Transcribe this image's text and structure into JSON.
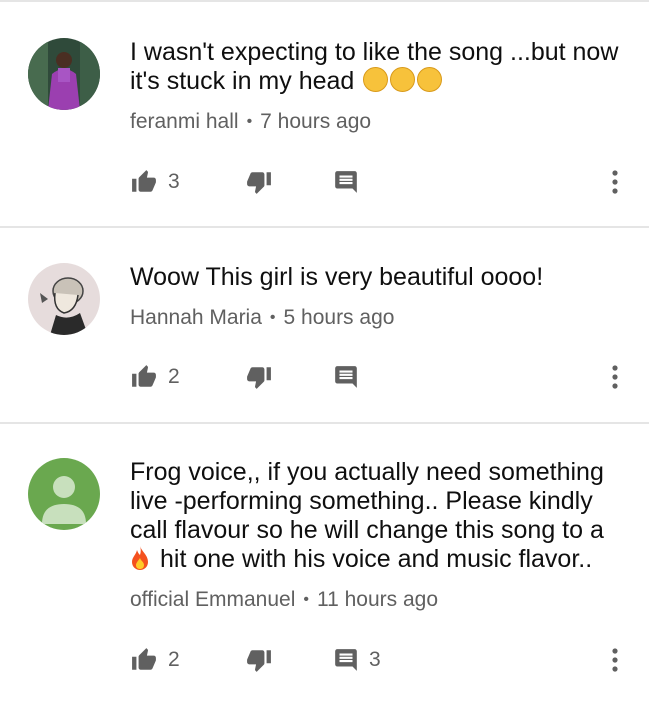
{
  "comments": [
    {
      "text": "I wasn't  expecting to like the song ...but now it's stuck in my head",
      "emoji_suffix": [
        "relieved-face-emoji",
        "relieved-face-emoji",
        "relieved-face-emoji"
      ],
      "author": "feranmi hall",
      "separator": "•",
      "time": "7 hours ago",
      "likes": "3",
      "replies": "",
      "avatar": "photo-avatar-purple-dress"
    },
    {
      "text": "Woow This girl is very beautiful oooo!",
      "author": "Hannah Maria",
      "separator": "•",
      "time": "5 hours ago",
      "likes": "2",
      "replies": "",
      "avatar": "sketch-avatar-man"
    },
    {
      "text_lines": [
        "Frog voice,, if you actually need something",
        "live -performing something.. Please kindly",
        "call flavour so he will change this song to a",
        "hit one with his voice and music flavor.."
      ],
      "line4_prefix_icon": "fire-emoji",
      "author": "official Emmanuel",
      "separator": "•",
      "time": "11 hours ago",
      "likes": "2",
      "replies": "3",
      "avatar": "default-avatar-green"
    }
  ],
  "icons": {
    "like": "thumbs-up-icon",
    "dislike": "thumbs-down-icon",
    "reply": "reply-comment-icon",
    "more": "more-vertical-icon"
  },
  "colors": {
    "text": "#0f0f0f",
    "meta": "#606060",
    "divider": "#e5e5e5",
    "default_avatar": "#6aa84f"
  }
}
